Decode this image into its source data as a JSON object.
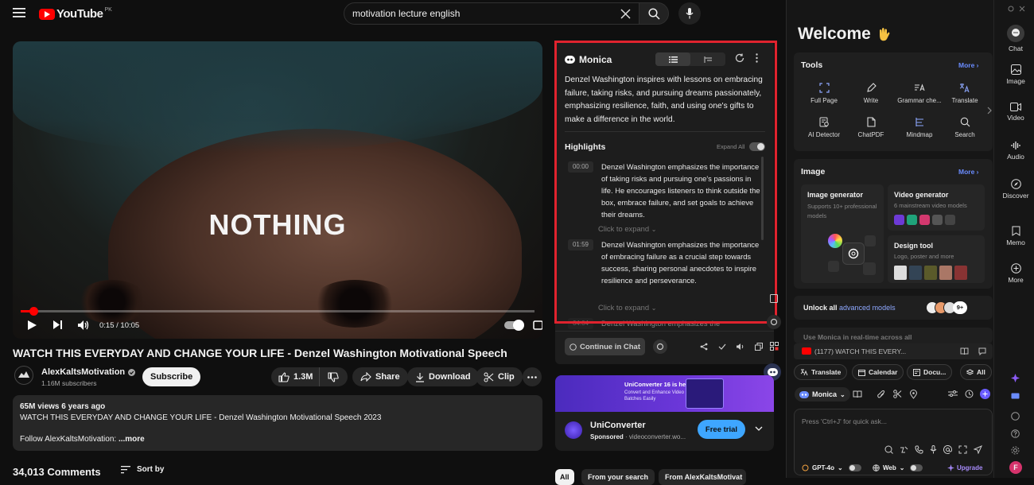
{
  "youtube": {
    "logo_text": "YouTube",
    "logo_region": "PK",
    "search_value": "motivation lecture english",
    "video_overlay_text": "NOTHING",
    "time_current": "0:15",
    "time_separator": "/",
    "time_total": "10:05",
    "watch_progress": 0.025,
    "title": "WATCH THIS EVERYDAY AND CHANGE YOUR LIFE - Denzel Washington Motivational Speech",
    "channel_name": "AlexKaltsMotivation",
    "subscribers": "1.16M subscribers",
    "subscribe_label": "Subscribe",
    "likes": "1.3M",
    "share_label": "Share",
    "download_label": "Download",
    "clip_label": "Clip",
    "views_date": "65M views  6 years ago",
    "description_line": "WATCH THIS EVERYDAY AND CHANGE YOUR LIFE - Denzel Washington Motivational Speech 2023",
    "description_follow": "Follow AlexKaltsMotivation:",
    "more_label": "...more",
    "comments_count": "34,013 Comments",
    "sort_label": "Sort by",
    "filter_chips": [
      "All",
      "From your search",
      "From AlexKaltsMotivat"
    ]
  },
  "summary": {
    "brand": "Monica",
    "text": "Denzel Washington inspires with lessons on embracing failure, taking risks, and pursuing dreams passionately, emphasizing resilience, faith, and using one's gifts to make a difference in the world.",
    "highlights_title": "Highlights",
    "expand_all": "Expand All",
    "items": [
      {
        "time": "00:00",
        "text": "Denzel Washington emphasizes the importance of taking risks and pursuing one's passions in life. He encourages listeners to think outside the box, embrace failure, and set goals to achieve their dreams.",
        "expand": "Click to expand"
      },
      {
        "time": "01:59",
        "text": "Denzel Washington emphasizes the importance of embracing failure as a crucial step towards success, sharing personal anecdotes to inspire resilience and perseverance.",
        "expand": "Click to expand"
      },
      {
        "time": "04:04",
        "text": "Denzel Washington emphasizes the"
      }
    ],
    "continue_label": "Continue in Chat"
  },
  "ad": {
    "banner_title": "UniConverter 16 is here!",
    "banner_sub": "Convert and Enhance Video in Batches Easily",
    "name": "UniConverter",
    "sponsored": "Sponsored",
    "url": "videoconverter.wo...",
    "cta": "Free trial"
  },
  "monica": {
    "welcome": "Welcome",
    "tools_title": "Tools",
    "more_label": "More",
    "tools": [
      "Full Page",
      "Write",
      "Grammar che...",
      "Translate",
      "AI Detector",
      "ChatPDF",
      "Mindmap",
      "Search"
    ],
    "image_title": "Image",
    "image_generator_title": "Image generator",
    "image_generator_sub": "Supports 10+ professional models",
    "video_generator_title": "Video generator",
    "video_generator_sub": "6 mainstream video models",
    "design_title": "Design tool",
    "design_sub": "Logo, poster and more",
    "unlock_prefix": "Unlock all",
    "unlock_link": "advanced models",
    "badge_count": "9+",
    "realtime_text": "Use Monica in real-time across all",
    "tab_context": "(1177) WATCH THIS EVERY...",
    "chips": [
      "Translate",
      "Calendar",
      "Docu...",
      "All"
    ],
    "bot_name": "Monica",
    "input_placeholder": "Press 'Ctrl+J' for quick ask...",
    "model": "GPT-4o",
    "web_label": "Web",
    "upgrade": "Upgrade",
    "nav": [
      "Chat",
      "Image",
      "Video",
      "Audio",
      "Discover",
      "Memo",
      "More"
    ],
    "user_initial": "F"
  },
  "colors": {
    "youtube_red": "#ff0000",
    "highlight_border": "#e0232e",
    "monica_blue": "#6a8cff",
    "ad_cta": "#3ea6ff",
    "upgrade_purple": "#a78bfa"
  }
}
